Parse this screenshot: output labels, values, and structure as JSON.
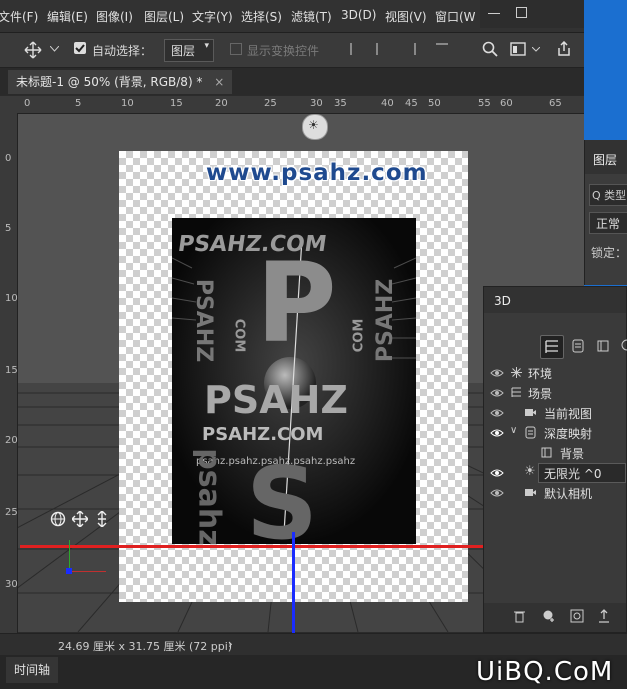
{
  "menubar": {
    "items": [
      "文件(F)",
      "编辑(E)",
      "图像(I)",
      "图层(L)",
      "文字(Y)",
      "选择(S)",
      "滤镜(T)",
      "3D(D)",
      "视图(V)",
      "窗口(W"
    ]
  },
  "options": {
    "auto_select_label": "自动选择：",
    "auto_select_value": "图层",
    "show_transform_label": "显示变换控件"
  },
  "document": {
    "tab_title": "未标题-1 @ 50% (背景, RGB/8) *",
    "close_glyph": "×"
  },
  "rulers": {
    "h_labels": [
      "0",
      "5",
      "10",
      "15",
      "20",
      "25",
      "30",
      "35",
      "40",
      "45",
      "50",
      "55",
      "60",
      "65"
    ],
    "v_labels": [
      "0",
      "5",
      "10",
      "15",
      "20",
      "25",
      "30"
    ]
  },
  "canvas": {
    "watermark": "www.psahz.com",
    "art_texts": {
      "top": "PSAHZ.COM",
      "big_p": "P",
      "middle": "PSAHZ",
      "lower": "PSAHZ.COM",
      "small_row": "psahz.psahz.psahz.psahz.psahz",
      "side_left": "PSAHZ",
      "side_right": "PSAHZ",
      "com_a": "COM",
      "com_b": "COM",
      "bottom_s": "S",
      "psahz_lower": "psahz"
    }
  },
  "status": {
    "dimensions": "24.69 厘米 x 31.75 厘米 (72 ppi)",
    "arrow": "›"
  },
  "timeline": {
    "label": "时间轴"
  },
  "watermark_bottom": "UiBQ.CoM",
  "layers_panel": {
    "tab": "图层",
    "search_placeholder": "Q 类型",
    "blend_mode": "正常",
    "lock_label": "锁定："
  },
  "panel3d": {
    "tab": "3D",
    "rows": [
      {
        "label": "环境",
        "indent": 0
      },
      {
        "label": "场景",
        "indent": 0
      },
      {
        "label": "当前视图",
        "indent": 1
      },
      {
        "label": "深度映射",
        "indent": 1
      },
      {
        "label": "背景",
        "indent": 2
      },
      {
        "label": "无限光 ^0",
        "indent": 1
      },
      {
        "label": "默认相机",
        "indent": 1
      }
    ]
  },
  "colors": {
    "axis_x": "#e02020",
    "axis_y": "#1a2cff",
    "axis_z": "#2ea82e",
    "desktop_blue": "#1b6fd0",
    "watermark_blue": "#1f4a8f"
  },
  "icons": [
    "move-icon",
    "chevron-down-icon",
    "checkbox-checked-icon",
    "search-icon",
    "window-icon",
    "share-icon",
    "light-orb-icon",
    "eye-icon",
    "orbit-icon",
    "pan-icon",
    "slide-icon",
    "trash-icon",
    "light-add-icon",
    "mesh-icon",
    "render-icon",
    "filter-icon"
  ]
}
